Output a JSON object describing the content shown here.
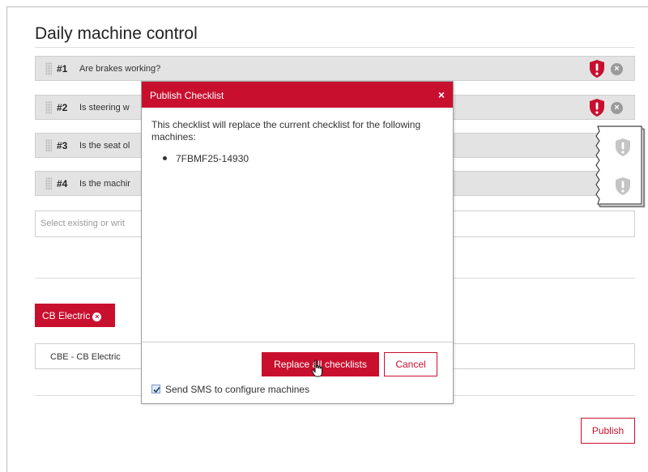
{
  "page": {
    "title": "Daily machine control"
  },
  "checklist": [
    {
      "num": "#1",
      "text": "Are brakes working?",
      "warning": true
    },
    {
      "num": "#2",
      "text": "Is steering w",
      "warning": true
    },
    {
      "num": "#3",
      "text": "Is the seat ol",
      "warning": false
    },
    {
      "num": "#4",
      "text": "Is the machir",
      "warning": false
    }
  ],
  "select": {
    "placeholder": "Select existing or writ"
  },
  "tag": {
    "label": "CB Electric"
  },
  "machine_field": {
    "value": "CBE - CB Electric"
  },
  "publish_label": "Publish",
  "modal": {
    "title": "Publish Checklist",
    "close_symbol": "×",
    "message": "This checklist will replace the current checklist for the following machines:",
    "machines": [
      "7FBMF25-14930"
    ],
    "replace_label": "Replace all checklists",
    "cancel_label": "Cancel",
    "sms_label": "Send SMS to configure machines",
    "sms_checked": true
  },
  "colors": {
    "brand": "#c8102e",
    "row_bg": "#e3e3e3",
    "inactive_icon": "#9a9a9a"
  },
  "icons": {
    "warning_active": "shield-exclamation-icon",
    "warning_inactive": "shield-exclamation-icon",
    "remove": "close-circle-icon"
  }
}
